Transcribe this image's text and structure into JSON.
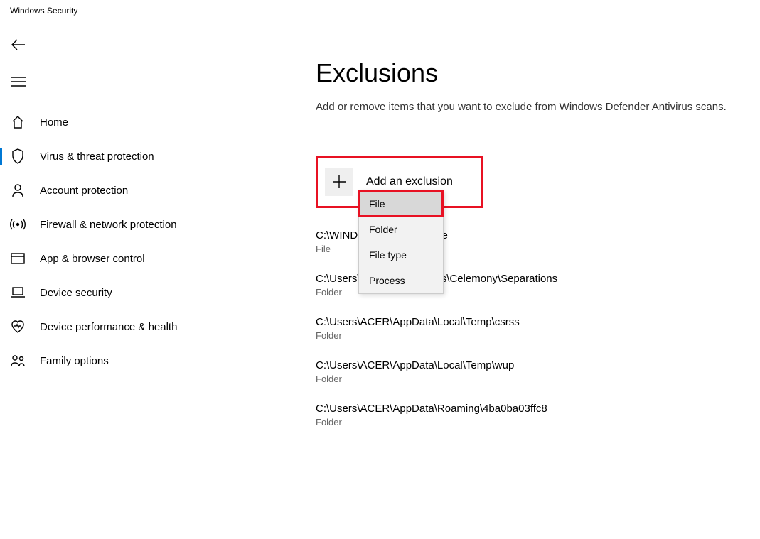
{
  "window": {
    "title": "Windows Security"
  },
  "sidebar": {
    "items": [
      {
        "label": "Home"
      },
      {
        "label": "Virus & threat protection"
      },
      {
        "label": "Account protection"
      },
      {
        "label": "Firewall & network protection"
      },
      {
        "label": "App & browser control"
      },
      {
        "label": "Device security"
      },
      {
        "label": "Device performance & health"
      },
      {
        "label": "Family options"
      }
    ]
  },
  "page": {
    "title": "Exclusions",
    "description": "Add or remove items that you want to exclude from Windows Defender Antivirus scans.",
    "add_label": "Add an exclusion"
  },
  "dropdown": {
    "items": [
      "File",
      "Folder",
      "File type",
      "Process"
    ]
  },
  "exclusions": [
    {
      "path": "C:\\WINDOWS\\reminder.exe",
      "type": "File"
    },
    {
      "path": "C:\\Users\\ACER\\Documents\\Celemony\\Separations",
      "type": "Folder"
    },
    {
      "path": "C:\\Users\\ACER\\AppData\\Local\\Temp\\csrss",
      "type": "Folder"
    },
    {
      "path": "C:\\Users\\ACER\\AppData\\Local\\Temp\\wup",
      "type": "Folder"
    },
    {
      "path": "C:\\Users\\ACER\\AppData\\Roaming\\4ba0ba03ffc8",
      "type": "Folder"
    }
  ]
}
